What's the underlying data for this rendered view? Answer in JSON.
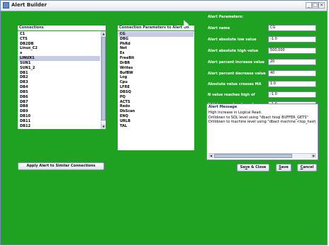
{
  "window": {
    "title": "Alert Builder",
    "controls": {
      "minimize": "_",
      "maximize": "□",
      "close": "×"
    }
  },
  "connections": {
    "header": "Connections",
    "items": [
      "C1",
      "CTS",
      "DB2DB",
      "Linux_C2",
      "x",
      "LINUX1",
      "SUN1",
      "SUN1_2",
      "DB1",
      "DB2",
      "DB3",
      "DB4",
      "DB5",
      "DB6",
      "DB7",
      "DB8",
      "DB9",
      "DB10",
      "DB11",
      "DB12"
    ],
    "selected_index": 5
  },
  "parameters": {
    "header": "Connection Parameters to Alert On",
    "items": [
      "CG",
      "DBG",
      "PhRd",
      "Net",
      "Ex",
      "FreeBlt",
      "DrBR",
      "Writes",
      "BufBW",
      "Log",
      "Cpu",
      "LFRE",
      "DBSQ",
      "PQ",
      "ACTS",
      "Redo",
      "DbScan",
      "ENQ",
      "URLB",
      "TAL"
    ],
    "selected_index": 0
  },
  "alert_params": {
    "header": "Alert Parameters:",
    "fields": [
      {
        "label": "Alert name",
        "value": "CG"
      },
      {
        "label": "Alert absolute low value",
        "value": "-1.0"
      },
      {
        "label": "Alert absolute high value",
        "value": "500,000"
      },
      {
        "label": "Alert percent increase value",
        "value": "20"
      },
      {
        "label": "Alert percent decrease value",
        "value": "40"
      },
      {
        "label": "Absolute value crosses MA",
        "value": "1.0"
      },
      {
        "label": "N value reaches high of",
        "value": "-1.0"
      },
      {
        "label": "N Value reaches low of",
        "value": "-1.0"
      }
    ]
  },
  "alert_message": {
    "title": "Alert Message",
    "text": "High Increase in Logical Read.\nDrilldown to SQL level using \"dbact hisql BUFFER_GETS\"\nDrilldown to machine level using \"dbact machine <top_hash_v"
  },
  "buttons": {
    "apply_similar": "Apply Alert to Similar Connections",
    "save_close_pre": "Sa",
    "save_close_u": "v",
    "save_close_post": "e & Close",
    "save_u": "S",
    "save_post": "ave",
    "cancel_u": "C",
    "cancel_post": "ancel"
  }
}
